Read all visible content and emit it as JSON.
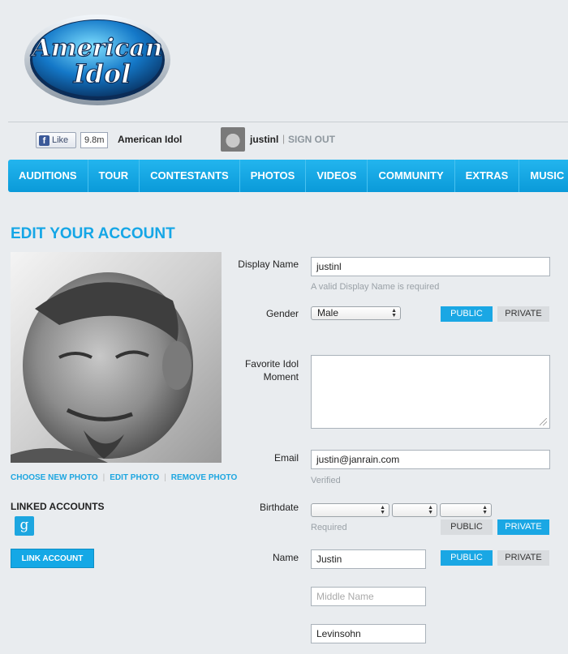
{
  "logo": {
    "line1": "American",
    "line2": "Idol"
  },
  "social": {
    "like_label": "Like",
    "like_count": "9.8m",
    "site_name": "American Idol",
    "username": "justinl",
    "separator": "|",
    "signout": "SIGN OUT"
  },
  "nav": {
    "items": [
      {
        "label": "AUDITIONS"
      },
      {
        "label": "TOUR"
      },
      {
        "label": "CONTESTANTS"
      },
      {
        "label": "PHOTOS"
      },
      {
        "label": "VIDEOS"
      },
      {
        "label": "COMMUNITY"
      },
      {
        "label": "EXTRAS"
      },
      {
        "label": "MUSIC"
      }
    ]
  },
  "page": {
    "title": "EDIT YOUR ACCOUNT"
  },
  "photo_links": {
    "choose": "CHOOSE NEW PHOTO",
    "edit": "EDIT PHOTO",
    "remove": "REMOVE PHOTO"
  },
  "linked": {
    "title": "LINKED ACCOUNTS",
    "google_glyph": "g",
    "link_button": "LINK ACCOUNT"
  },
  "form": {
    "display_name": {
      "label": "Display Name",
      "value": "justinl",
      "hint": "A valid Display Name is required"
    },
    "gender": {
      "label": "Gender",
      "value": "Male",
      "public": "PUBLIC",
      "private": "PRIVATE",
      "visibility": "public"
    },
    "favorite": {
      "label_line1": "Favorite Idol",
      "label_line2": "Moment",
      "value": ""
    },
    "email": {
      "label": "Email",
      "value": "justin@janrain.com",
      "hint": "Verified"
    },
    "birthdate": {
      "label": "Birthdate",
      "hint": "Required",
      "public": "PUBLIC",
      "private": "PRIVATE",
      "visibility": "private"
    },
    "name": {
      "label": "Name",
      "first": "Justin",
      "middle_placeholder": "Middle Name",
      "last": "Levinsohn",
      "public": "PUBLIC",
      "private": "PRIVATE",
      "visibility": "public"
    }
  },
  "colors": {
    "accent": "#1aa7e4",
    "nav": "#0a9ad9",
    "background": "#e9ecef"
  }
}
